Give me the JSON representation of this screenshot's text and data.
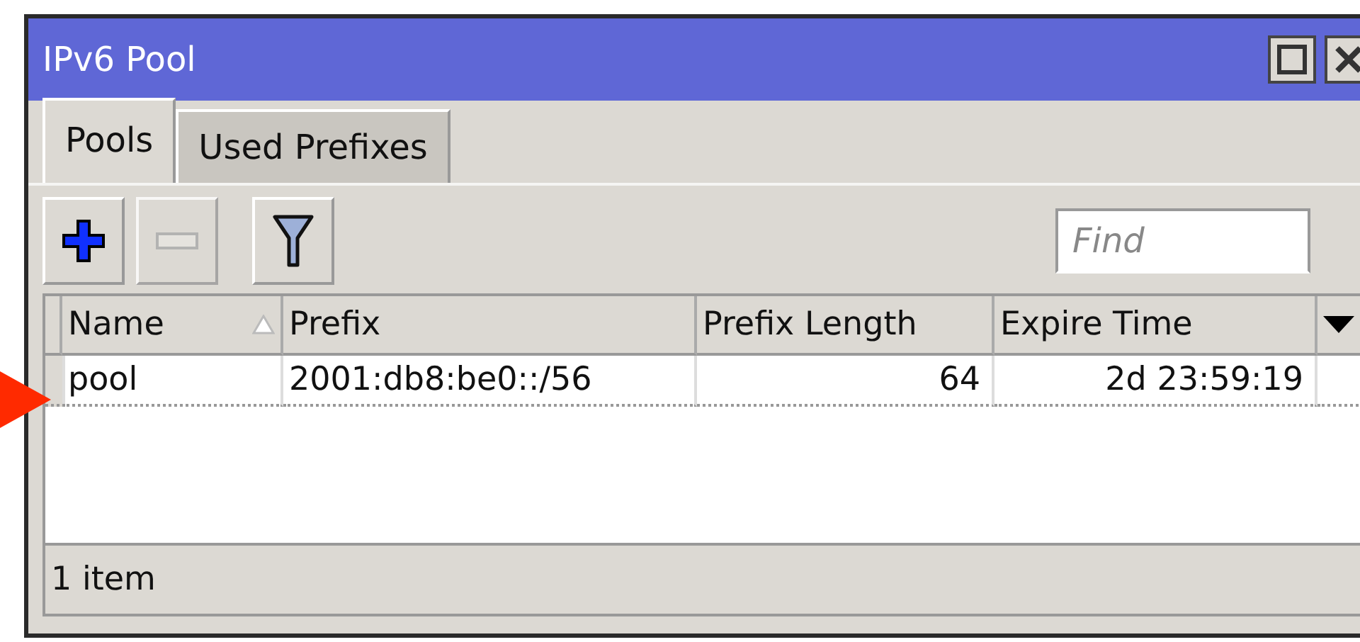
{
  "window": {
    "title": "IPv6 Pool"
  },
  "tabs": [
    {
      "label": "Pools",
      "selected": true
    },
    {
      "label": "Used Prefixes",
      "selected": false
    }
  ],
  "toolbar": [
    {
      "kind": "add",
      "disabled": false
    },
    {
      "kind": "remove",
      "disabled": true
    },
    {
      "kind": "filter",
      "disabled": false
    }
  ],
  "search": {
    "placeholder": "Find"
  },
  "table": {
    "columns": [
      {
        "label": "Name",
        "sorted": true
      },
      {
        "label": "Prefix",
        "sorted": false
      },
      {
        "label": "Prefix Length",
        "sorted": false
      },
      {
        "label": "Expire Time",
        "sorted": false
      }
    ],
    "rows": [
      {
        "cells": [
          "pool",
          "2001:db8:be0::/56",
          "64",
          "2d 23:59:19"
        ]
      }
    ]
  },
  "status_bar": "1 item"
}
